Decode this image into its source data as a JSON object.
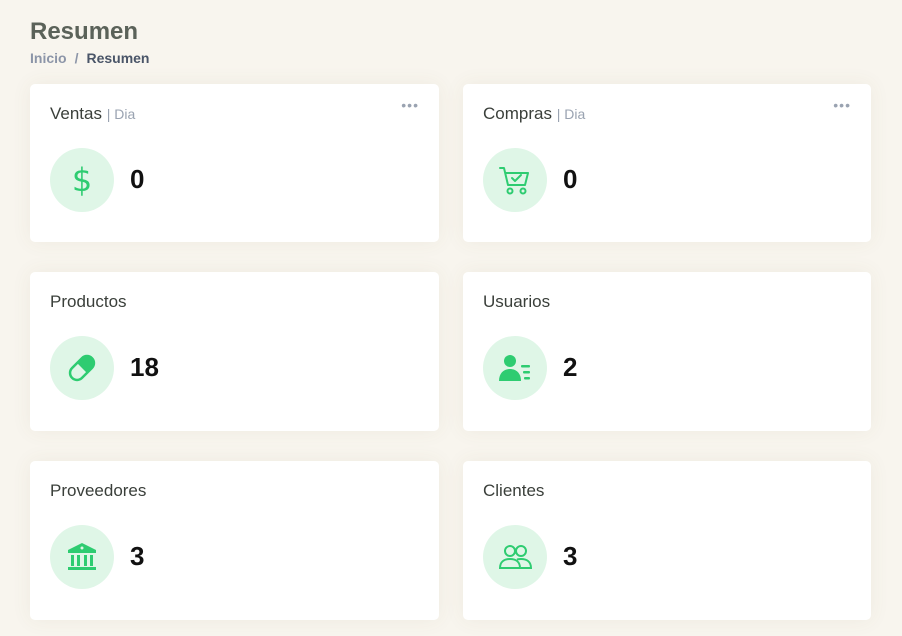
{
  "header": {
    "title": "Resumen",
    "breadcrumb": {
      "home": "Inicio",
      "separator": "/",
      "current": "Resumen"
    }
  },
  "accent_color": "#2ecc71",
  "cards": {
    "ventas": {
      "title": "Ventas",
      "period": "| Dia",
      "value": "0",
      "icon": "dollar-icon"
    },
    "compras": {
      "title": "Compras",
      "period": "| Dia",
      "value": "0",
      "icon": "cart-icon"
    },
    "productos": {
      "title": "Productos",
      "value": "18",
      "icon": "pill-icon"
    },
    "usuarios": {
      "title": "Usuarios",
      "value": "2",
      "icon": "user-list-icon"
    },
    "proveedores": {
      "title": "Proveedores",
      "value": "3",
      "icon": "bank-icon"
    },
    "clientes": {
      "title": "Clientes",
      "value": "3",
      "icon": "people-icon"
    }
  }
}
